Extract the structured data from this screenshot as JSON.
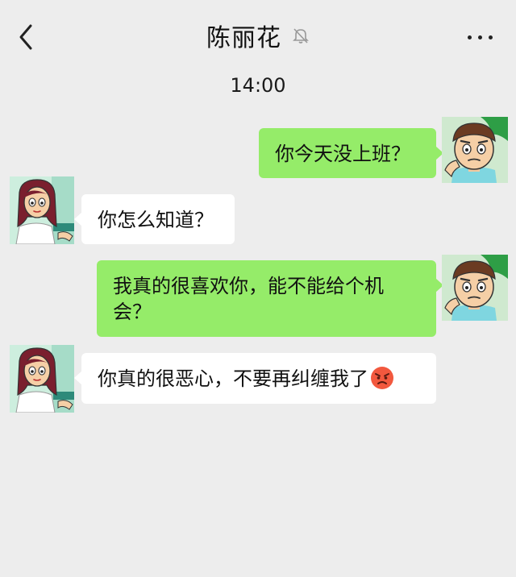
{
  "header": {
    "title": "陈丽花",
    "back_icon": "chevron-left-icon",
    "mute_icon": "bell-off-icon",
    "more_icon": "more-horizontal-icon"
  },
  "timestamp": "14:00",
  "colors": {
    "background": "#ededed",
    "my_bubble": "#95ec69",
    "other_bubble": "#ffffff"
  },
  "messages": [
    {
      "sender": "me",
      "text": "你今天没上班？"
    },
    {
      "sender": "other",
      "text": "你怎么知道？"
    },
    {
      "sender": "me",
      "line1": "我真的很喜欢你，能不能给个机",
      "line2": "会？"
    },
    {
      "sender": "other",
      "text": "你真的很恶心，不要再纠缠我了",
      "emoji": "angry-face-emoji"
    }
  ]
}
